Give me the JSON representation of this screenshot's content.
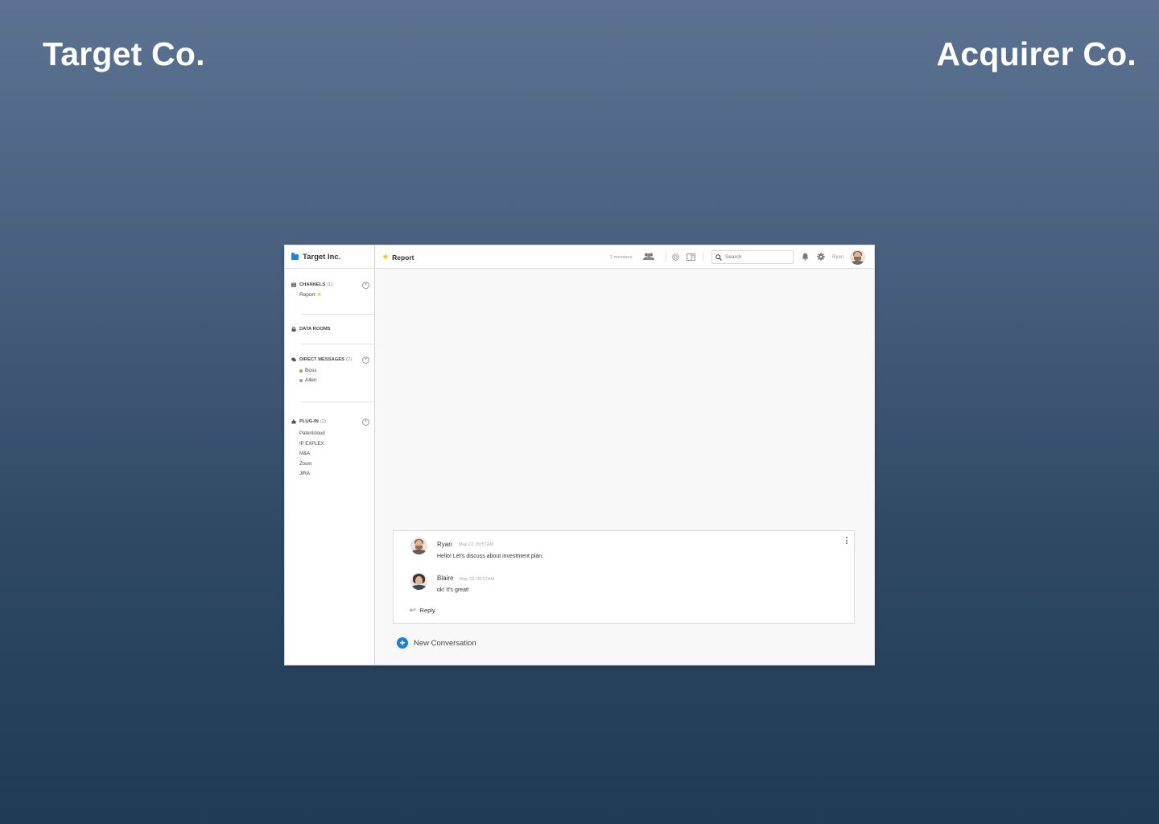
{
  "slide": {
    "left_title": "Target Co.",
    "right_title": "Acquirer Co."
  },
  "sidebar": {
    "workspace_name": "Target Inc.",
    "channels": {
      "label": "CHANNELS",
      "count": "(1)",
      "items": [
        {
          "label": "Report"
        }
      ]
    },
    "data_rooms": {
      "label": "DATA ROOMS"
    },
    "direct_messages": {
      "label": "DIRECT MESSAGES",
      "count": "(2)",
      "items": [
        {
          "label": "Boss",
          "status_color": "#7bc043"
        },
        {
          "label": "Allen",
          "status_color": "#9e9e9e"
        }
      ]
    },
    "plugins": {
      "label": "PLUG-IN",
      "count": "(2)",
      "items": [
        {
          "label": "Patentcloud"
        },
        {
          "label": "IP EXPLEX"
        },
        {
          "label": "M&A"
        },
        {
          "label": "Zoom"
        },
        {
          "label": "JIRA"
        }
      ]
    }
  },
  "header": {
    "channel_title": "Report",
    "members_label": "2 members",
    "search_placeholder": "Search",
    "user_name": "Ryan"
  },
  "thread": {
    "messages": [
      {
        "author": "Ryan",
        "time": "May 22, 09:57AM",
        "text": "Hello!  Let's discuss about investment plan."
      },
      {
        "author": "Blaire",
        "time": "May 22, 09:57AM",
        "text": "ok! It's great!"
      }
    ],
    "reply_label": "Reply"
  },
  "new_conversation_label": "New Conversation",
  "colors": {
    "accent": "#1d7fd6",
    "star": "#f5c518",
    "online": "#7bc043"
  },
  "icons": {
    "workspace": "folder-icon",
    "channels": "channels-icon",
    "data_rooms": "lock-icon",
    "direct_messages": "chat-bubbles-icon",
    "plugins": "puzzle-icon",
    "members": "people-icon",
    "settings_circle": "target-icon",
    "panel": "side-panel-icon",
    "search": "search-icon",
    "notifications": "bell-icon",
    "settings": "gear-icon",
    "reply": "reply-arrow-icon",
    "more": "kebab-menu-icon",
    "add": "plus-circle-icon"
  }
}
